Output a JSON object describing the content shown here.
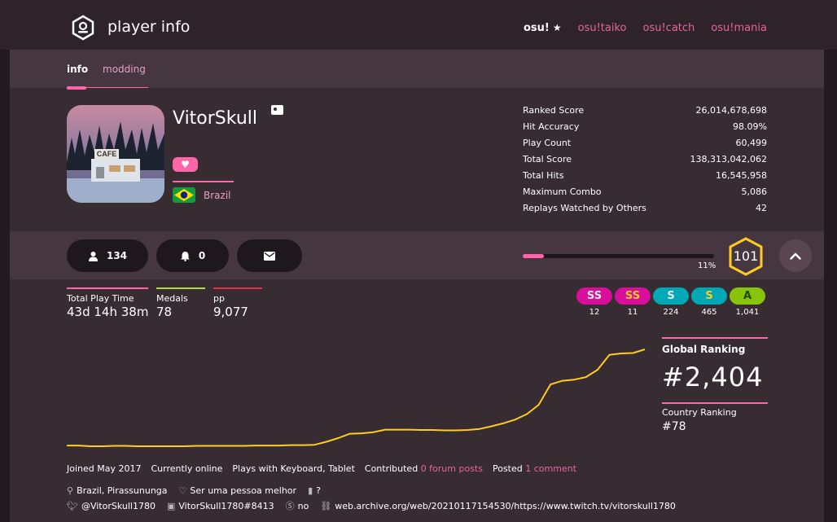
{
  "header": {
    "title": "player info",
    "modes": [
      {
        "label": "osu!",
        "active": true
      },
      {
        "label": "osu!taiko",
        "active": false
      },
      {
        "label": "osu!catch",
        "active": false
      },
      {
        "label": "osu!mania",
        "active": false
      }
    ]
  },
  "tabs": {
    "info": "info",
    "modding": "modding"
  },
  "profile": {
    "username": "VitorSkull",
    "country": "Brazil",
    "avatar_sign": "CAFE"
  },
  "stats": [
    {
      "label": "Ranked Score",
      "value": "26,014,678,698"
    },
    {
      "label": "Hit Accuracy",
      "value": "98.09%"
    },
    {
      "label": "Play Count",
      "value": "60,499"
    },
    {
      "label": "Total Score",
      "value": "138,313,042,062"
    },
    {
      "label": "Total Hits",
      "value": "16,545,958"
    },
    {
      "label": "Maximum Combo",
      "value": "5,086"
    },
    {
      "label": "Replays Watched by Others",
      "value": "42"
    }
  ],
  "actions": {
    "followers": "134",
    "notifications": "0"
  },
  "level": {
    "value": "101",
    "progress_label": "11%",
    "progress": 0.11
  },
  "mini_stats": {
    "play_time_label": "Total Play Time",
    "play_time": "43d 14h 38m",
    "medals_label": "Medals",
    "medals": "78",
    "pp_label": "pp",
    "pp": "9,077"
  },
  "grades": [
    {
      "grade": "SS",
      "count": "12",
      "color": "#d70f9a"
    },
    {
      "grade": "SS",
      "count": "11",
      "color": "#d70f9a"
    },
    {
      "grade": "S",
      "count": "224",
      "color": "#00a8b5"
    },
    {
      "grade": "S",
      "count": "465",
      "color": "#00a8b5"
    },
    {
      "grade": "A",
      "count": "1,041",
      "color": "#88c40b"
    }
  ],
  "ranking": {
    "global_label": "Global Ranking",
    "global": "#2,404",
    "country_label": "Country Ranking",
    "country": "#78"
  },
  "chart_data": {
    "type": "line",
    "series": [
      {
        "values": [
          1,
          1,
          0.98,
          0.98,
          0.99,
          0.99,
          0.98,
          0.98,
          0.98,
          0.98,
          0.98,
          0.99,
          0.99,
          0.99,
          0.99,
          0.99,
          1,
          1,
          1,
          1.01,
          1.01,
          1.02,
          1.1,
          1.2,
          1.32,
          1.33,
          1.36,
          1.43,
          1.43,
          1.43,
          1.42,
          1.42,
          1.41,
          1.41,
          1.42,
          1.45,
          1.52,
          1.6,
          1.7,
          1.85,
          2.1,
          2.65,
          2.75,
          2.78,
          2.85,
          3.05,
          3.45,
          3.49,
          3.5,
          3.6
        ]
      }
    ],
    "color": "#ffcc22",
    "grid": false
  },
  "footer": {
    "joined": "Joined May 2017",
    "online": "Currently online",
    "plays_with": "Plays with Keyboard, Tablet",
    "contributed_prefix": "Contributed",
    "forum_posts": "0 forum posts",
    "posted_prefix": "Posted",
    "comments": "1 comment",
    "location": "Brazil, Pirassununga",
    "interests": "Ser uma pessoa melhor",
    "occupation": "?",
    "twitter": "@VitorSkull1780",
    "discord": "VitorSkull1780#8413",
    "skype": "no",
    "website": "web.archive.org/web/20210117154530/https://www.twitch.tv/vitorskull1780"
  },
  "colors": {
    "accent": "#ff66aa",
    "level_ring": "#ffcc22",
    "background": "#382c33"
  }
}
